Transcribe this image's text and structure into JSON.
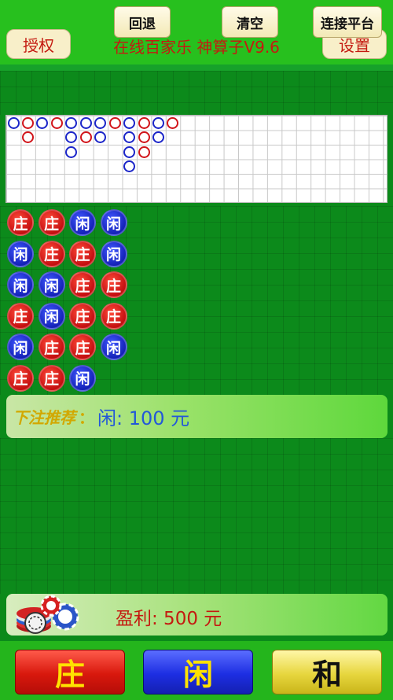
{
  "header": {
    "auth_label": "授权",
    "title": "在线百家乐 神算子V9.6",
    "settings_label": "设置"
  },
  "toolbar": {
    "undo_label": "回退",
    "clear_label": "清空",
    "connect_label": "连接平台"
  },
  "big_road": [
    [
      "blue"
    ],
    [
      "red",
      "red"
    ],
    [
      "blue"
    ],
    [
      "red"
    ],
    [
      "blue",
      "blue",
      "blue"
    ],
    [
      "blue",
      "red"
    ],
    [
      "blue",
      "blue"
    ],
    [
      "red"
    ],
    [
      "blue",
      "blue",
      "blue",
      "blue"
    ],
    [
      "red",
      "red",
      "red"
    ],
    [
      "blue",
      "blue"
    ],
    [
      "red"
    ]
  ],
  "bead_plate": [
    [
      "庄",
      "庄",
      "闲",
      "闲"
    ],
    [
      "闲",
      "庄",
      "庄",
      "闲"
    ],
    [
      "闲",
      "闲",
      "庄",
      "庄"
    ],
    [
      "庄",
      "闲",
      "庄",
      "庄"
    ],
    [
      "闲",
      "庄",
      "庄",
      "闲"
    ],
    [
      "庄",
      "庄",
      "闲"
    ]
  ],
  "bead_colors": {
    "庄": "red",
    "闲": "blue"
  },
  "advice": {
    "label": "下注推荐",
    "colon": "：",
    "value": "闲: 100 元"
  },
  "profit": {
    "text": "盈利:  500 元"
  },
  "bets": {
    "banker": "庄",
    "player": "闲",
    "tie": "和"
  }
}
